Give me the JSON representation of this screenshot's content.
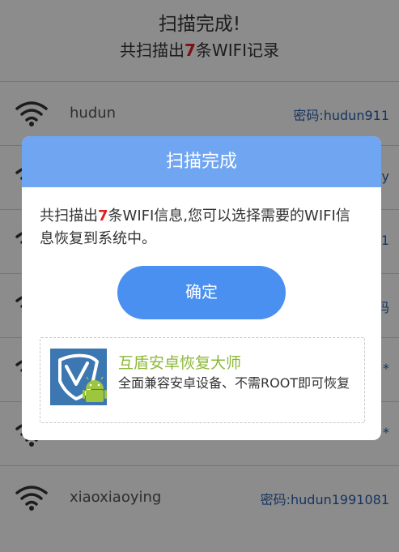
{
  "header": {
    "title": "扫描完成!",
    "subtitle_prefix": "共扫描出",
    "subtitle_count": "7",
    "subtitle_suffix": "条WIFI记录"
  },
  "wifi_list": [
    {
      "ssid": "hudun",
      "password": "密码:hudun911"
    },
    {
      "ssid": "",
      "password": "y"
    },
    {
      "ssid": "",
      "password": "1"
    },
    {
      "ssid": "",
      "password": "码"
    },
    {
      "ssid": "",
      "password": "*"
    },
    {
      "ssid": "",
      "password": "*"
    },
    {
      "ssid": "xiaoxiaoying",
      "password": "密码:hudun1991081"
    }
  ],
  "dialog": {
    "title": "扫描完成",
    "message_prefix": "共扫描出",
    "message_count": "7",
    "message_suffix": "条WIFI信息,您可以选择需要的WIFI信息恢复到系统中。",
    "ok_label": "确定",
    "promo": {
      "title": "互盾安卓恢复大师",
      "description": "全面兼容安卓设备、不需ROOT即可恢复",
      "logo_icon": "shield-android-logo-icon"
    }
  },
  "colors": {
    "dialog_header": "#70a6f1",
    "ok_button": "#4a90f0",
    "count_highlight": "#e02020",
    "password_text": "#2a5fb0",
    "promo_title": "#8db83a"
  }
}
